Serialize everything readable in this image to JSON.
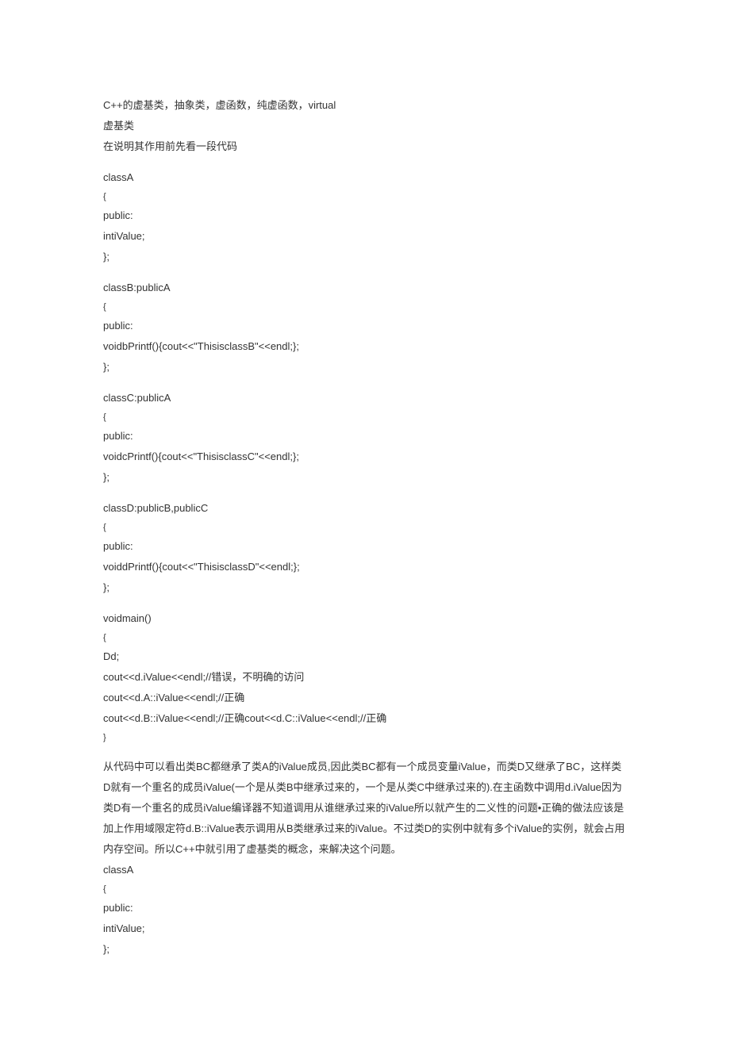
{
  "content": {
    "title": "C++的虚基类，抽象类，虚函数，纯虚函数，virtual",
    "sub1": "虚基类",
    "sub2": "在说明其作用前先看一段代码",
    "code1": [
      "classA",
      "{",
      "public:",
      "intiValue;",
      "};",
      "",
      "classB:publicA",
      "{",
      "public:",
      "voidbPrintf(){cout<<\"ThisisclassB\"<<endl;};",
      "};",
      "",
      "classC:publicA",
      "{",
      "public:",
      "voidcPrintf(){cout<<\"ThisisclassC\"<<endl;};",
      "};",
      "",
      "classD:publicB,publicC",
      "{",
      "public:",
      "voiddPrintf(){cout<<\"ThisisclassD\"<<endl;};",
      "};",
      "",
      "voidmain()",
      "{",
      "Dd;",
      "cout<<d.iValue<<endl;//错误，不明确的访问",
      "cout<<d.A::iValue<<endl;//正确",
      "cout<<d.B::iValue<<endl;//正确cout<<d.C::iValue<<endl;//正确",
      "}"
    ],
    "para1": "从代码中可以看出类BC都继承了类A的iValue成员,因此类BC都有一个成员变量iValue，而类D又继承了BC，这样类D就有一个重名的成员iValue(一个是从类B中继承过来的，一个是从类C中继承过来的).在主函数中调用d.iValue因为类D有一个重名的成员iValue编译器不知道调用从谁继承过来的iValue所以就产生的二义性的问题•正确的做法应该是加上作用域限定符d.B::iValue表示调用从B类继承过来的iValue。不过类D的实例中就有多个iValue的实例，就会占用内存空间。所以C++中就引用了虚基类的概念，来解决这个问题。",
    "code2": [
      "classA",
      "{",
      "public:",
      "intiValue;",
      "};"
    ]
  }
}
